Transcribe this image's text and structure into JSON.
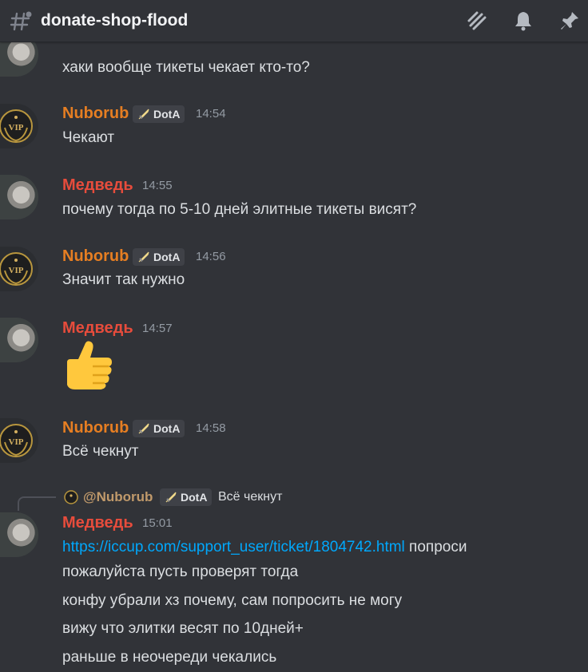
{
  "header": {
    "channel_name": "donate-shop-flood",
    "icons": [
      "hash-icon",
      "threads-icon",
      "bell-icon",
      "pin-icon"
    ]
  },
  "messages": [
    {
      "text": "хаки вообще тикеты чекает кто-то?"
    },
    {
      "author": "Nuborub",
      "role": "DotA",
      "time": "14:54",
      "text": "Чекают"
    },
    {
      "author": "Медведь",
      "time": "14:55",
      "text": "почему тогда по 5-10 дней элитные тикеты висят?"
    },
    {
      "author": "Nuborub",
      "role": "DotA",
      "time": "14:56",
      "text": "Значит так нужно"
    },
    {
      "author": "Медведь",
      "time": "14:57",
      "emoji": "thumbs-up"
    },
    {
      "author": "Nuborub",
      "role": "DotA",
      "time": "14:58",
      "text": "Всё чекнут"
    },
    {
      "reply": {
        "author": "@Nuborub",
        "role": "DotA",
        "text": "Всё чекнут"
      },
      "author": "Медведь",
      "time": "15:01",
      "link": "https://iccup.com/support_user/ticket/1804742.html",
      "after_link": " попроси",
      "lines": [
        "пожалуйста пусть проверят тогда",
        "конфу убрали хз почему, сам попросить не могу",
        "вижу что элитки весят по 10дней+",
        "раньше в неочереди чекались"
      ]
    }
  ],
  "colors": {
    "background": "#313338",
    "nuborub": "#e67e22",
    "medved": "#e74c3c",
    "link": "#00a8fc"
  }
}
